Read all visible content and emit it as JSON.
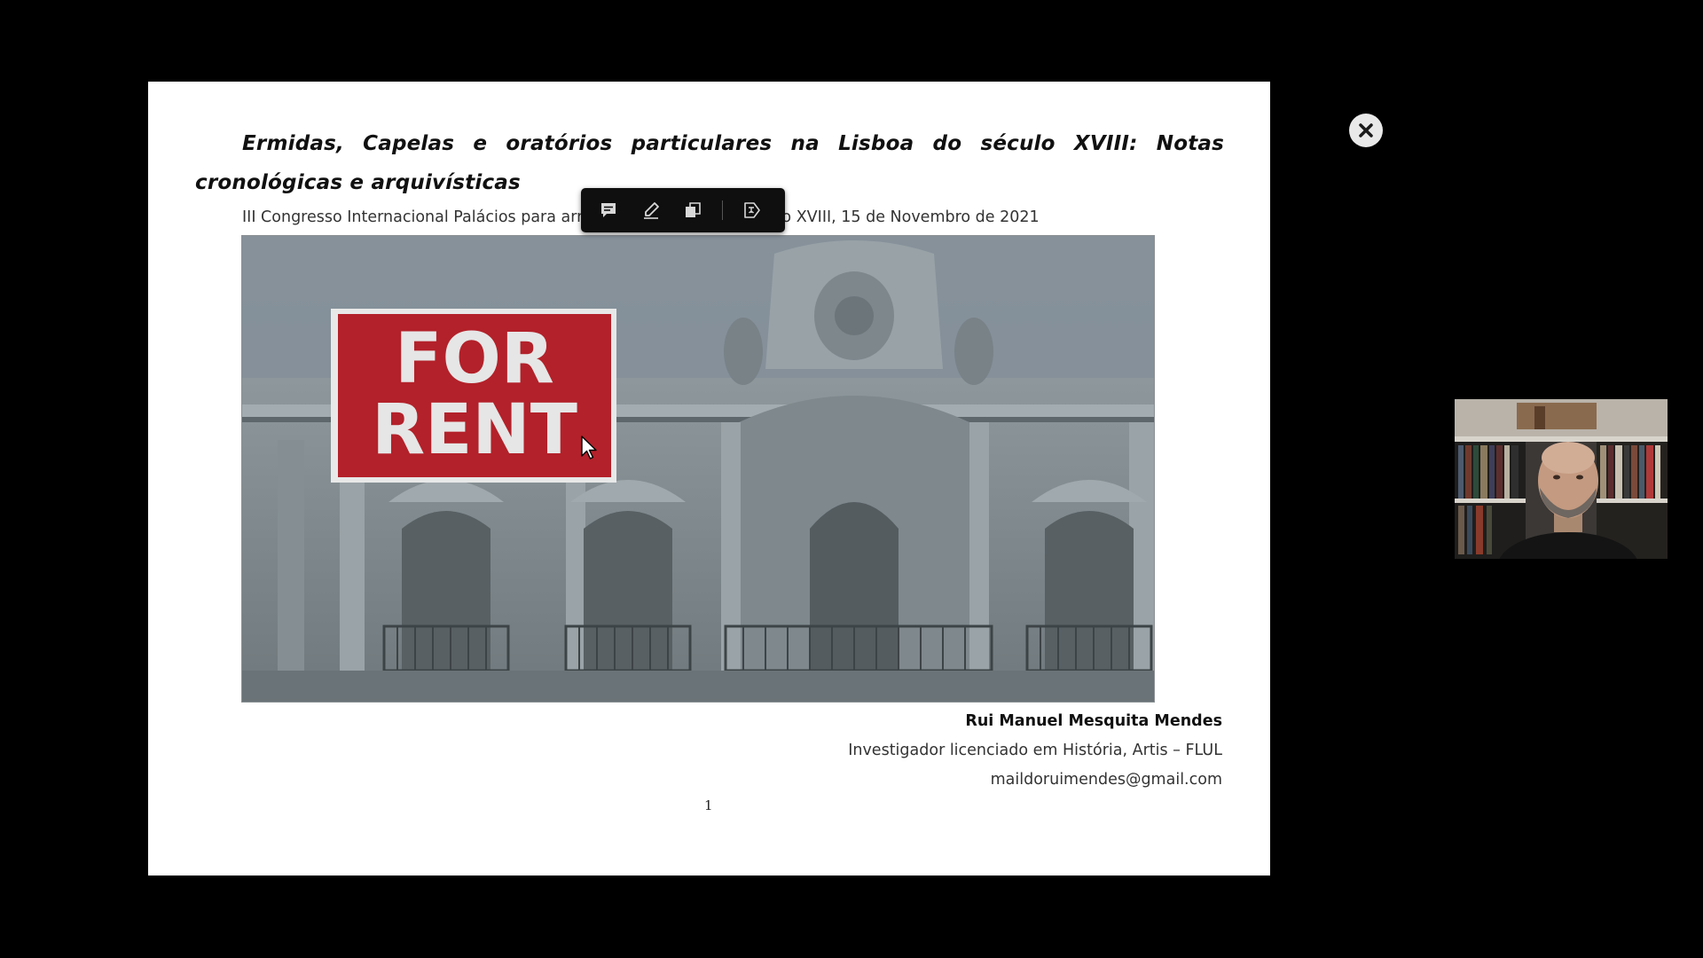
{
  "document": {
    "title": "Ermidas, Capelas e oratórios particulares na Lisboa do século XVIII: Notas cronológicas e arquivísticas",
    "subtitle": "III Congresso Internacional Palácios para arrendar em Lisboa no século XVIII, 15 de Novembro de 2021",
    "figure": {
      "sign_line1": "FOR",
      "sign_line2": "RENT"
    },
    "author": {
      "name": "Rui Manuel Mesquita Mendes",
      "affiliation": "Investigador licenciado em História, Artis – FLUL",
      "email": "maildoruimendes@gmail.com"
    },
    "page_number": "1"
  },
  "toolbar": {
    "icons": [
      "comment-icon",
      "highlighter-icon",
      "copy-icon",
      "translate-icon"
    ]
  },
  "viewer": {
    "close_icon": "close-icon"
  },
  "colors": {
    "background": "#000000",
    "page": "#ffffff",
    "toolbar": "#0f0f0f",
    "sign_red": "#b3212a"
  }
}
